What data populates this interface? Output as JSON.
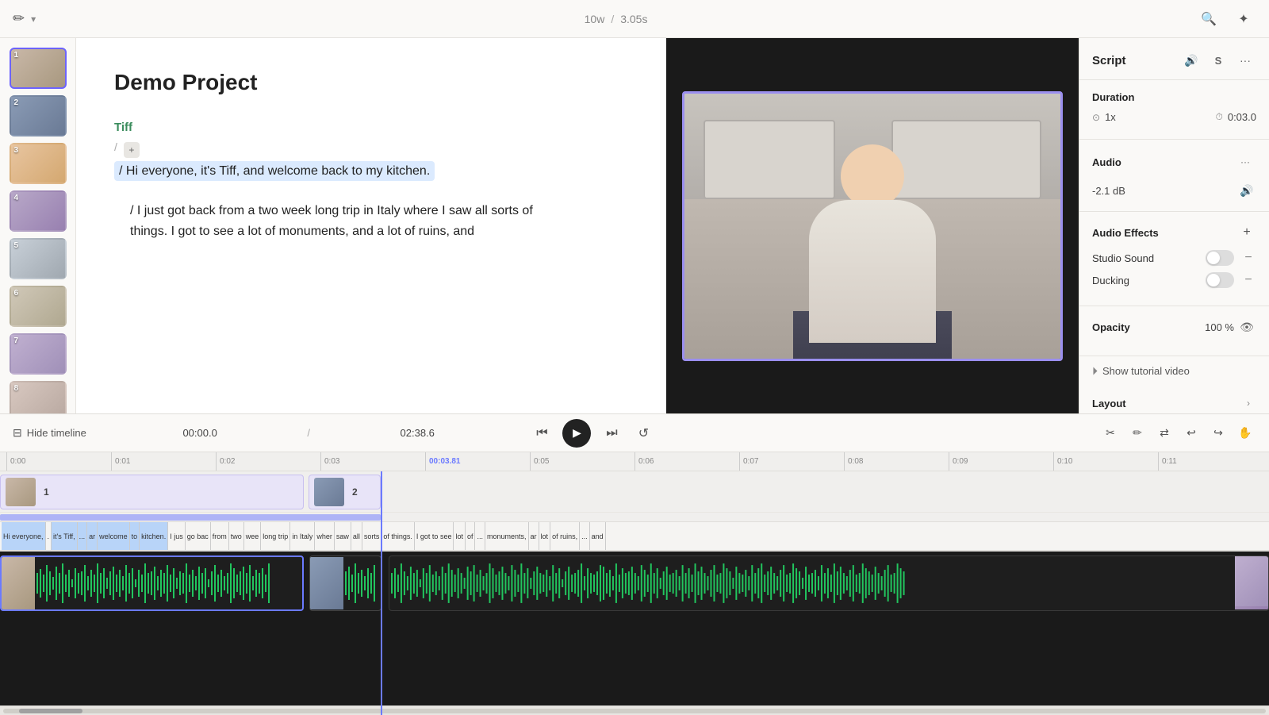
{
  "app": {
    "title": "Demo Project"
  },
  "topbar": {
    "speed_label": "10w",
    "separator": "/",
    "duration_label": "3.05s",
    "pen_icon": "✏",
    "chevron_icon": "▾",
    "search_icon": "🔍",
    "magic_icon": "✦"
  },
  "timeline_controls": {
    "hide_label": "Hide timeline",
    "hide_icon": "⊟",
    "time_current": "00:00.0",
    "time_separator": "/",
    "time_total": "02:38.6",
    "skip_back_icon": "⏮",
    "play_icon": "▶",
    "skip_forward_icon": "⏭",
    "loop_icon": "↺"
  },
  "script": {
    "title": "Demo Project",
    "speaker": "Tiff",
    "paragraph_1": "/ Hi everyone, it's Tiff, and welcome back to my kitchen.",
    "paragraph_2": "/ I just got back from a two week long trip in Italy where I saw all sorts of things. I got to see a lot of monuments, and a lot of ruins, and"
  },
  "right_panel": {
    "title": "Script",
    "duration_section": {
      "title": "Duration",
      "speed_label": "1x",
      "speed_icon": "⊙",
      "time_icon": "⏱",
      "time_value": "0:03.0"
    },
    "audio_section": {
      "title": "Audio",
      "value": "-2.1 dB",
      "volume_icon": "🔊",
      "more_icon": "···"
    },
    "audio_effects_section": {
      "title": "Audio Effects",
      "add_icon": "+",
      "studio_sound_label": "Studio Sound",
      "ducking_label": "Ducking"
    },
    "opacity_section": {
      "title": "Opacity",
      "value": "100 %",
      "eye_icon": "👁"
    },
    "tutorial": {
      "icon": "▶",
      "label": "Show tutorial video"
    },
    "layout_section": {
      "title": "Layout",
      "expand_icon": "›"
    }
  },
  "timeline": {
    "ruler_marks": [
      "0:00",
      "0:01",
      "0:02",
      "0:03",
      "00:03.81",
      "0:05",
      "0:06",
      "0:07",
      "0:08",
      "0:09",
      "0:10",
      "0:11"
    ],
    "clip_1_label": "1",
    "clip_2_label": "2",
    "caption_words": [
      "Hi everyone,",
      ".",
      "it's Tiff,",
      "...",
      "ar",
      "welcome",
      "to",
      "kitchen.",
      "I jus",
      "go bac",
      "from",
      "two",
      "wee",
      "long trip",
      "in Italy",
      "wher",
      "saw",
      "all",
      "sorts",
      "of things.",
      "I got to see",
      "lot",
      "of",
      "...",
      "monuments,",
      "ar",
      "lot",
      "of ruins,",
      "...",
      "and"
    ]
  }
}
